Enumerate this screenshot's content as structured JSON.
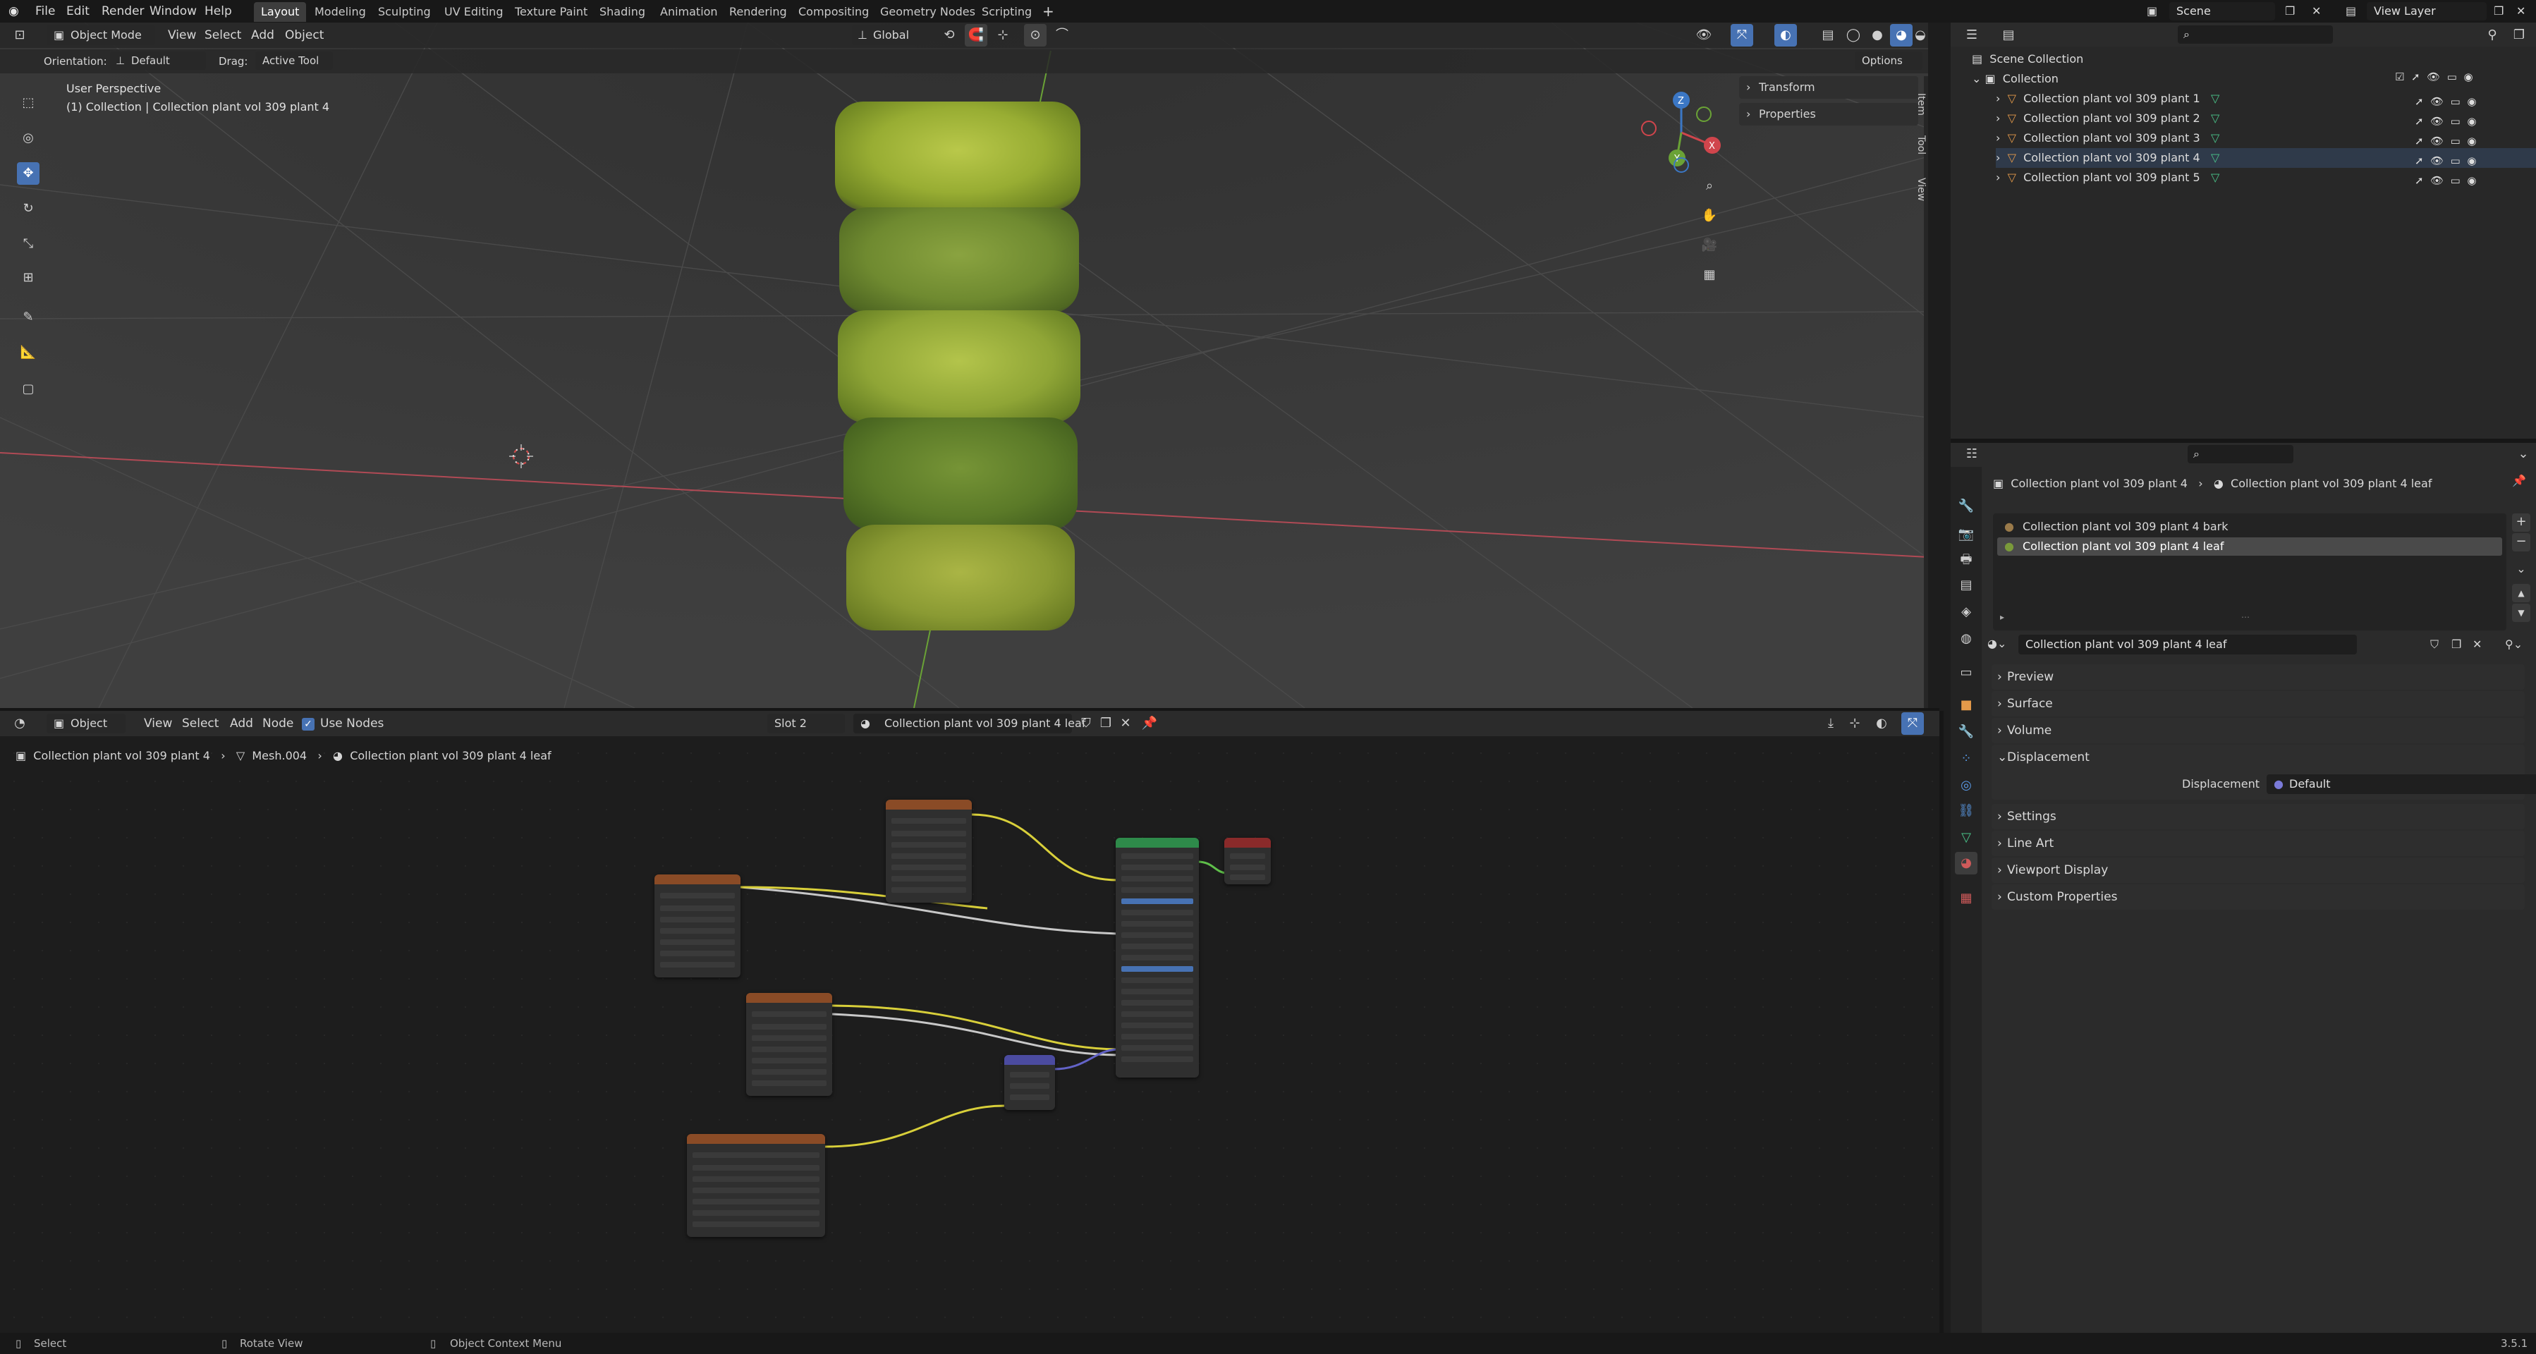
{
  "app_menu": [
    "File",
    "Edit",
    "Render",
    "Window",
    "Help"
  ],
  "workspaces": [
    "Layout",
    "Modeling",
    "Sculpting",
    "UV Editing",
    "Texture Paint",
    "Shading",
    "Animation",
    "Rendering",
    "Compositing",
    "Geometry Nodes",
    "Scripting"
  ],
  "scene": {
    "name": "Scene",
    "view_layer": "View Layer"
  },
  "viewport": {
    "mode": "Object Mode",
    "menus": [
      "View",
      "Select",
      "Add",
      "Object"
    ],
    "transform": "Global",
    "orientation_label": "Orientation:",
    "orientation_value": "Default",
    "drag_label": "Drag:",
    "drag_value": "Active Tool",
    "options": "Options",
    "perspective": "User Perspective",
    "collection_info": "(1) Collection | Collection plant vol 309 plant 4",
    "side_panels": [
      "Transform",
      "Properties"
    ],
    "side_tabs": [
      "Item",
      "Tool",
      "View"
    ]
  },
  "node_editor": {
    "editor_type": "Object",
    "menus": [
      "View",
      "Select",
      "Add",
      "Node"
    ],
    "use_nodes": "Use Nodes",
    "slot": "Slot 2",
    "material": "Collection plant vol 309 plant 4 leaf",
    "breadcrumb": [
      "Collection plant vol 309 plant 4",
      "Mesh.004",
      "Collection plant vol 309 plant 4 leaf"
    ]
  },
  "outliner": {
    "root": "Scene Collection",
    "collection": "Collection",
    "items": [
      "Collection plant vol 309 plant 1",
      "Collection plant vol 309 plant 2",
      "Collection plant vol 309 plant 3",
      "Collection plant vol 309 plant 4",
      "Collection plant vol 309 plant 5"
    ]
  },
  "properties": {
    "breadcrumb": [
      "Collection plant vol 309 plant 4",
      "Collection plant vol 309 plant 4 leaf"
    ],
    "material_slots": [
      "Collection plant vol 309 plant 4 bark",
      "Collection plant vol 309 plant 4 leaf"
    ],
    "material_name": "Collection plant vol 309 plant 4 leaf",
    "panels": [
      "Preview",
      "Surface",
      "Volume",
      "Displacement",
      "Settings",
      "Line Art",
      "Viewport Display",
      "Custom Properties"
    ],
    "displacement_label": "Displacement",
    "displacement_value": "Default"
  },
  "status": {
    "select": "Select",
    "rotate": "Rotate View",
    "context": "Object Context Menu",
    "version": "3.5.1"
  }
}
